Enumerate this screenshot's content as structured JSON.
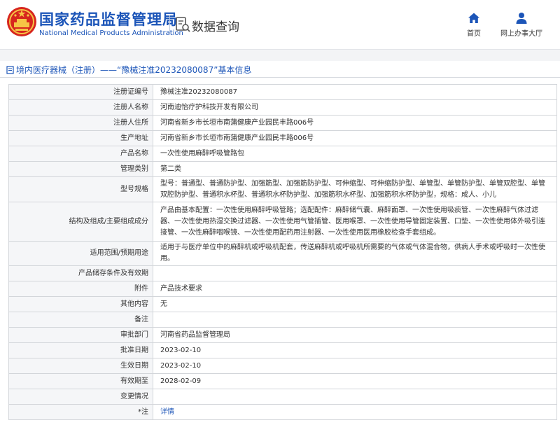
{
  "header": {
    "site_title_cn": "国家药品监督管理局",
    "site_title_en": "National Medical Products Administration",
    "module_label": "数据查询",
    "nav": [
      {
        "label": "首页",
        "icon": "home-icon"
      },
      {
        "label": "网上办事大厅",
        "icon": "user-icon"
      }
    ]
  },
  "section": {
    "title": "境内医疗器械（注册）——“豫械注准20232080087”基本信息"
  },
  "colors": {
    "brand_blue": "#1c55b8",
    "label_bg": "#f5f6f8",
    "border": "#d3d6da"
  },
  "table": {
    "rows": [
      {
        "label": "注册证编号",
        "value": "豫械注准20232080087"
      },
      {
        "label": "注册人名称",
        "value": "河南迪怡疗护科技开发有限公司"
      },
      {
        "label": "注册人住所",
        "value": "河南省新乡市长垣市南蒲健康产业园民丰路006号"
      },
      {
        "label": "生产地址",
        "value": "河南省新乡市长垣市南蒲健康产业园民丰路006号"
      },
      {
        "label": "产品名称",
        "value": "一次性使用麻醉呼吸管路包"
      },
      {
        "label": "管理类别",
        "value": "第二类"
      },
      {
        "label": "型号规格",
        "value": "型号：普通型、普通防护型、加强筋型、加强筋防护型、可伸缩型、可伸缩防护型、单管型、单管防护型、单管双腔型、单管双腔防护型、普通积水杯型、普通积水杯防护型、加强筋积水杯型、加强筋积水杯防护型，规格：成人、小儿"
      },
      {
        "label": "结构及组成/主要组成成分",
        "value": "产品由基本配置：一次性使用麻醉呼吸管路；选配配件：麻醉储气囊、麻醉面罩、一次性使用吸痰管、一次性麻醉气体过滤器、一次性使用热湿交换过滤器、一次性使用气管插管、医用喉罩、一次性使用导管固定装置、口垫、一次性使用体外吸引连接管、一次性麻醉咽喉镜、一次性使用配药用注射器、一次性使用医用橡胶检查手套组成。"
      },
      {
        "label": "适用范围/预期用途",
        "value": "适用于与医疗单位中的麻醉机或呼吸机配套，传送麻醉机或呼吸机所需要的气体或气体混合物，供病人手术或呼吸时一次性使用。"
      },
      {
        "label": "产品储存条件及有效期",
        "value": ""
      },
      {
        "label": "附件",
        "value": "产品技术要求"
      },
      {
        "label": "其他内容",
        "value": "无"
      },
      {
        "label": "备注",
        "value": ""
      },
      {
        "label": "审批部门",
        "value": "河南省药品监督管理局"
      },
      {
        "label": "批准日期",
        "value": "2023-02-10"
      },
      {
        "label": "生效日期",
        "value": "2023-02-10"
      },
      {
        "label": "有效期至",
        "value": "2028-02-09"
      },
      {
        "label": "变更情况",
        "value": ""
      }
    ],
    "note_row": {
      "label": "注",
      "value": "详情"
    }
  }
}
